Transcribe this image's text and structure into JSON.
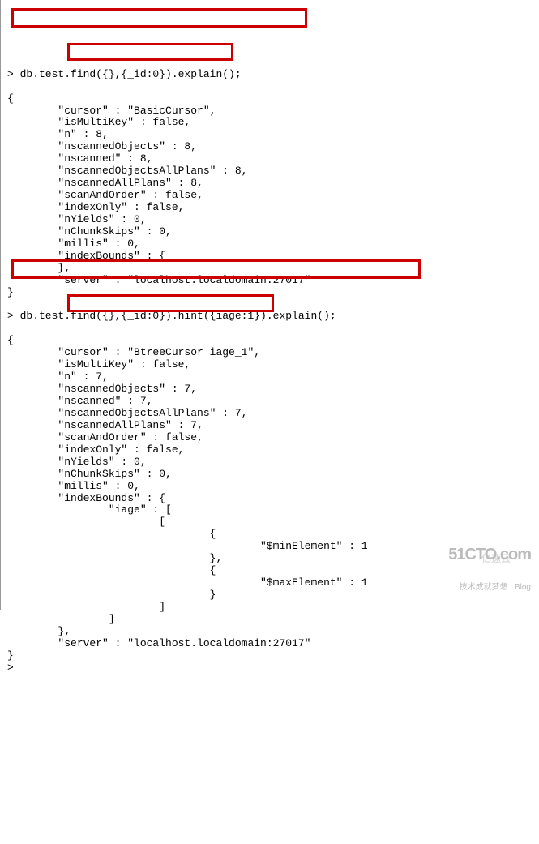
{
  "query1": {
    "cmd": "> db.test.find({},{_id:0}).explain();",
    "lines": [
      "{",
      "        \"cursor\" : \"BasicCursor\",",
      "        \"isMultiKey\" : false,",
      "        \"n\" : 8,",
      "        \"nscannedObjects\" : 8,",
      "        \"nscanned\" : 8,",
      "        \"nscannedObjectsAllPlans\" : 8,",
      "        \"nscannedAllPlans\" : 8,",
      "        \"scanAndOrder\" : false,",
      "        \"indexOnly\" : false,",
      "        \"nYields\" : 0,",
      "        \"nChunkSkips\" : 0,",
      "        \"millis\" : 0,",
      "        \"indexBounds\" : {",
      "",
      "        },",
      "        \"server\" : \"localhost.localdomain:27017\"",
      "}"
    ]
  },
  "query2": {
    "cmd": "> db.test.find({},{_id:0}).hint({iage:1}).explain();",
    "lines": [
      "{",
      "        \"cursor\" : \"BtreeCursor iage_1\",",
      "        \"isMultiKey\" : false,",
      "        \"n\" : 7,",
      "        \"nscannedObjects\" : 7,",
      "        \"nscanned\" : 7,",
      "        \"nscannedObjectsAllPlans\" : 7,",
      "        \"nscannedAllPlans\" : 7,",
      "        \"scanAndOrder\" : false,",
      "        \"indexOnly\" : false,",
      "        \"nYields\" : 0,",
      "        \"nChunkSkips\" : 0,",
      "        \"millis\" : 0,",
      "        \"indexBounds\" : {",
      "                \"iage\" : [",
      "                        [",
      "                                {",
      "                                        \"$minElement\" : 1",
      "                                },",
      "                                {",
      "                                        \"$maxElement\" : 1",
      "                                }",
      "                        ]",
      "                ]",
      "        },",
      "        \"server\" : \"localhost.localdomain:27017\"",
      "}",
      ">"
    ]
  },
  "watermark1": {
    "big": "51CTO.com",
    "sub": "技术成就梦想   Blog"
  },
  "watermark2": "亿速云"
}
